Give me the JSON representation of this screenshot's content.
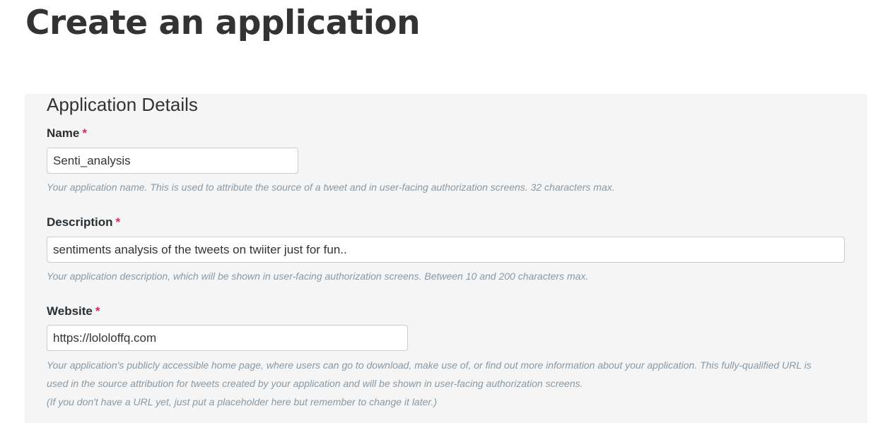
{
  "page": {
    "title": "Create an application"
  },
  "form": {
    "section_title": "Application Details",
    "required_marker": "*",
    "name": {
      "label": "Name",
      "value": "Senti_analysis",
      "help": "Your application name. This is used to attribute the source of a tweet and in user-facing authorization screens. 32 characters max."
    },
    "description": {
      "label": "Description",
      "value": "sentiments analysis of the tweets on twiiter just for fun..",
      "help": "Your application description, which will be shown in user-facing authorization screens. Between 10 and 200 characters max."
    },
    "website": {
      "label": "Website",
      "value": "https://lololoffq.com",
      "help_line1": "Your application's publicly accessible home page, where users can go to download, make use of, or find out more information about your application. This fully-qualified URL is",
      "help_line2": "used in the source attribution for tweets created by your application and will be shown in user-facing authorization screens.",
      "help_line3": "(If you don't have a URL yet, just put a placeholder here but remember to change it later.)"
    }
  },
  "colors": {
    "required": "#e0245e",
    "panel_background": "#f5f5f5",
    "help_text": "#8899a6"
  }
}
